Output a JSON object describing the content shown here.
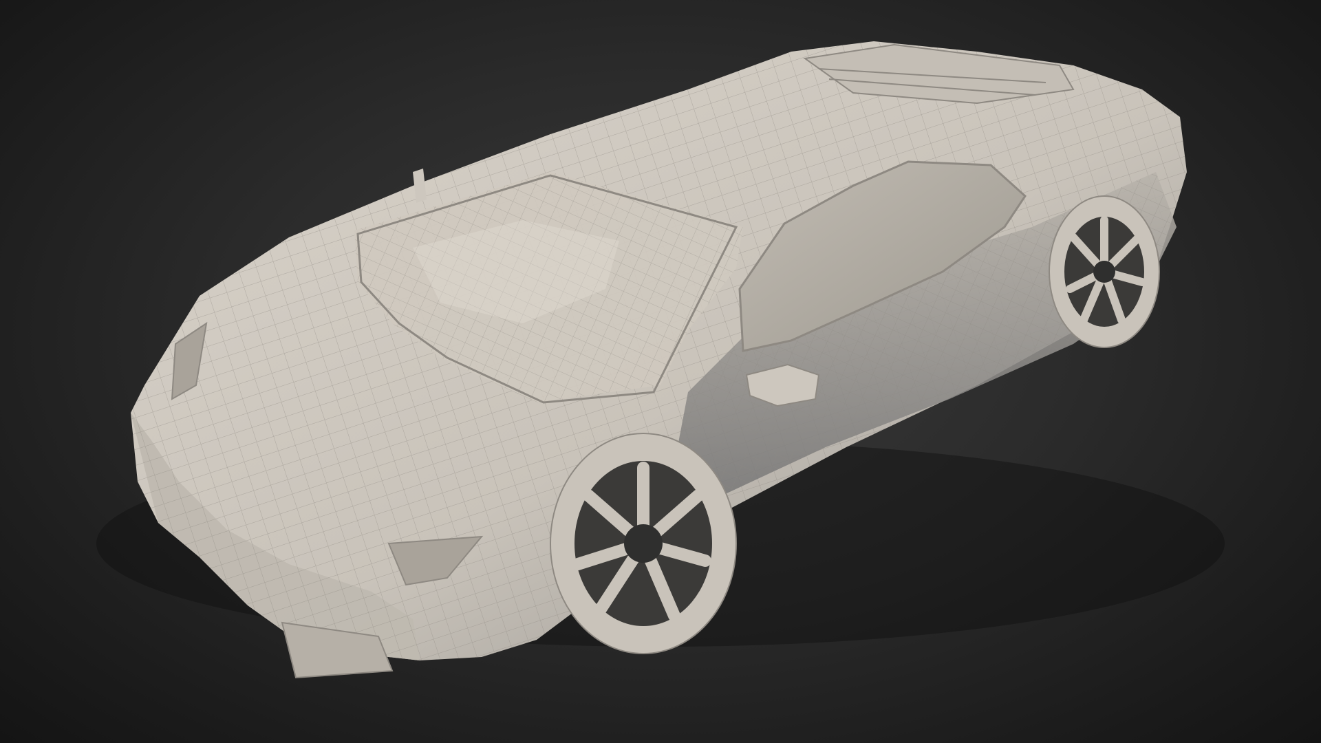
{
  "scene": {
    "subject": "car-wireframe-model",
    "colors": {
      "background_center": "#3a3a3a",
      "background_edge": "#141414",
      "body_light": "#d6d0c7",
      "body_mid": "#bdb7ae",
      "body_shadow": "#7d7c7a",
      "glass": "#b3ada4",
      "wire": "#8f8a83",
      "tire": "#c9c3ba",
      "rim_dark": "#3b3a38"
    }
  }
}
